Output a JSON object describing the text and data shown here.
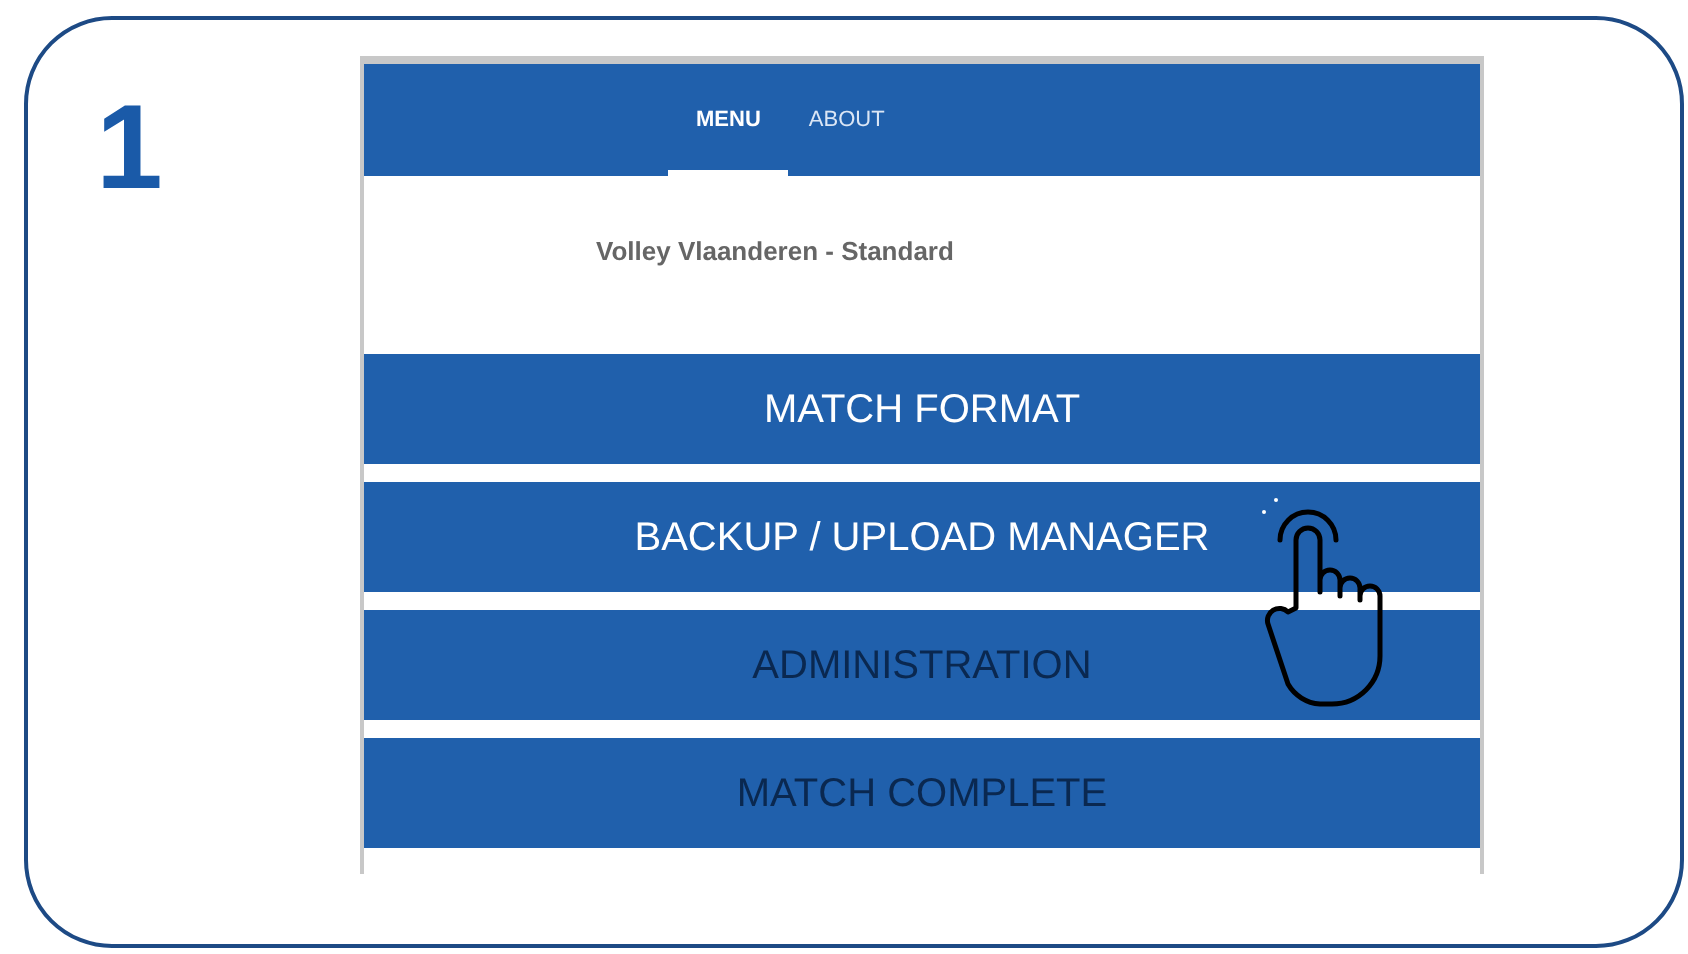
{
  "step_number": "1",
  "tabs": [
    {
      "label": "MENU",
      "selected": true
    },
    {
      "label": "ABOUT",
      "selected": false
    }
  ],
  "subtitle": "Volley Vlaanderen - Standard",
  "menu_items": [
    {
      "label": "MATCH FORMAT",
      "disabled": false
    },
    {
      "label": "BACKUP / UPLOAD MANAGER",
      "disabled": false
    },
    {
      "label": "ADMINISTRATION",
      "disabled": true
    },
    {
      "label": "MATCH COMPLETE",
      "disabled": true
    }
  ]
}
